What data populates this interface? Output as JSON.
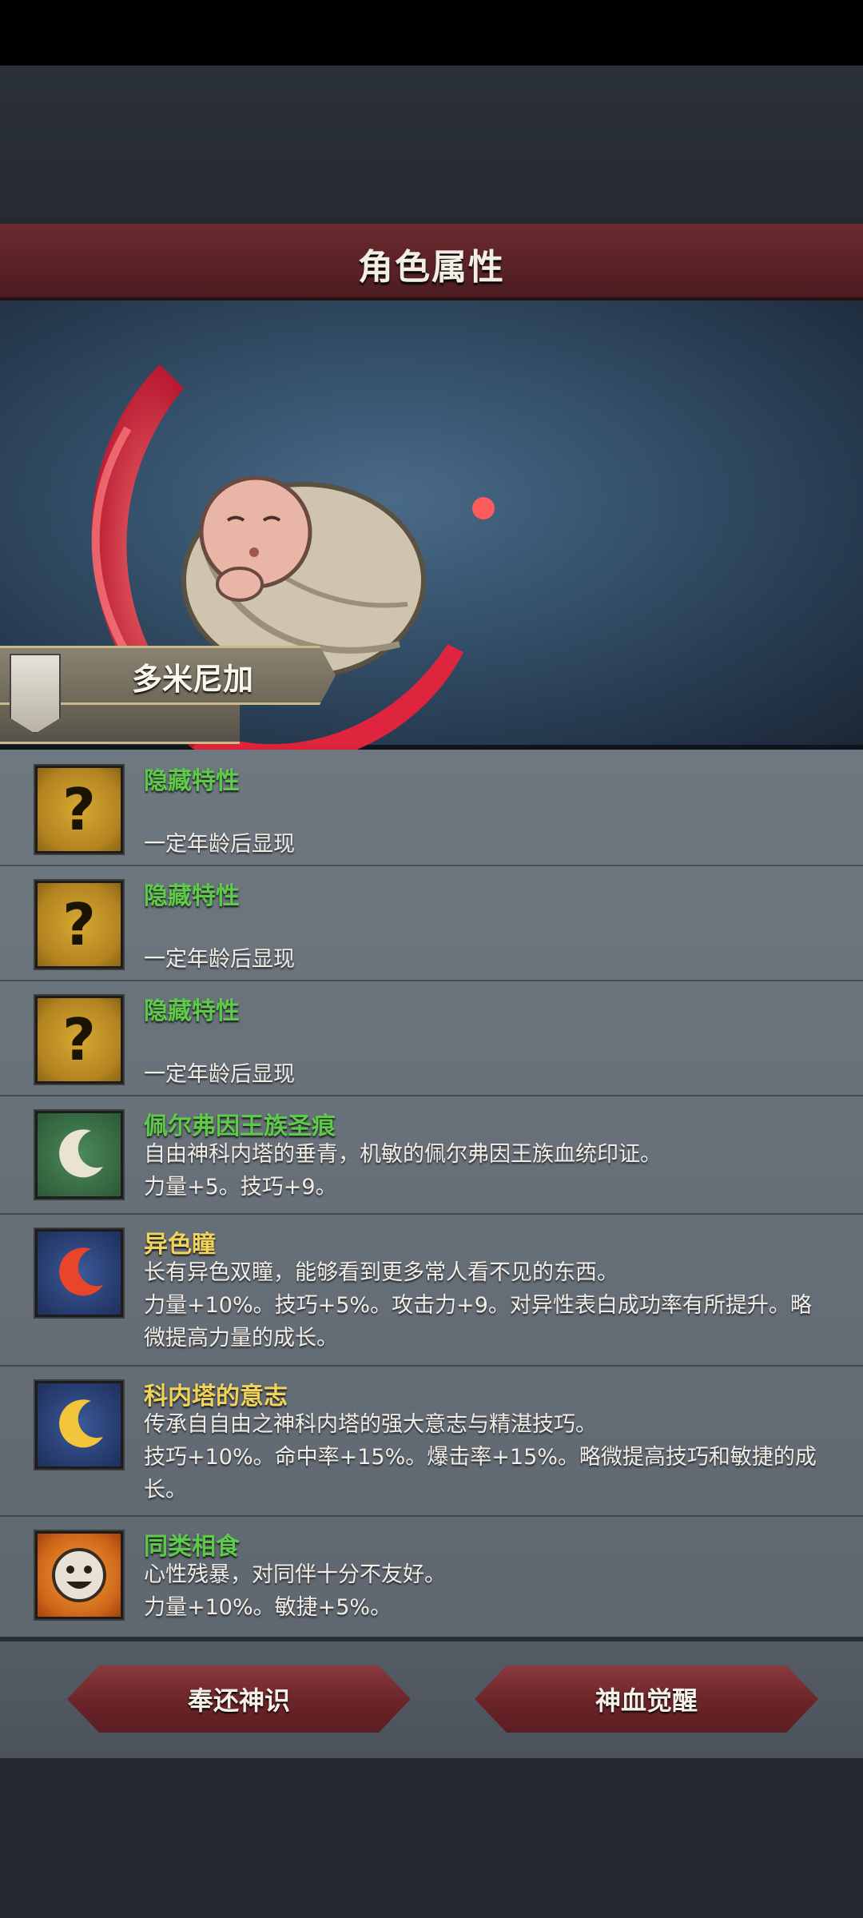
{
  "header": {
    "title": "角色属性"
  },
  "character": {
    "name": "多米尼加"
  },
  "traits": [
    {
      "name": "隐藏特性",
      "lines": [
        "一定年龄后显现"
      ],
      "icon": "question-icon",
      "color": "green"
    },
    {
      "name": "隐藏特性",
      "lines": [
        "一定年龄后显现"
      ],
      "icon": "question-icon",
      "color": "green"
    },
    {
      "name": "隐藏特性",
      "lines": [
        "一定年龄后显现"
      ],
      "icon": "question-icon",
      "color": "green"
    },
    {
      "name": "佩尔弗因王族圣痕",
      "lines": [
        "自由神科内塔的垂青，机敏的佩尔弗因王族血统印证。",
        "力量+5。技巧+9。"
      ],
      "icon": "white-moon-icon",
      "color": "green"
    },
    {
      "name": "异色瞳",
      "lines": [
        "长有异色双瞳，能够看到更多常人看不见的东西。",
        "力量+10%。技巧+5%。攻击力+9。对异性表白成功率有所提升。略微提高力量的成长。"
      ],
      "icon": "red-moon-icon",
      "color": "yellow"
    },
    {
      "name": "科内塔的意志",
      "lines": [
        "传承自自由之神科内塔的强大意志与精湛技巧。",
        "技巧+10%。命中率+15%。爆击率+15%。略微提高技巧和敏捷的成长。"
      ],
      "icon": "gold-moon-icon",
      "color": "yellow"
    },
    {
      "name": "同类相食",
      "lines": [
        "心性残暴，对同伴十分不友好。",
        "力量+10%。敏捷+5%。"
      ],
      "icon": "smiley-face-icon",
      "color": "green"
    }
  ],
  "buttons": {
    "return_label": "奉还神识",
    "awaken_label": "神血觉醒"
  },
  "colors": {
    "accent_red": "#6b2a2e",
    "trait_green": "#5ec94a",
    "trait_yellow": "#f0d35a"
  }
}
